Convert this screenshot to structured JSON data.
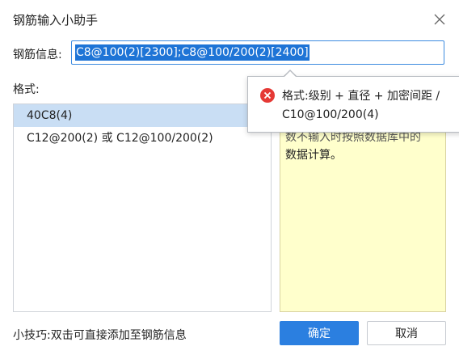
{
  "dialog": {
    "title": "钢筋输入小助手",
    "close_icon": "close-icon"
  },
  "info": {
    "label": "钢筋信息:",
    "value": "C8@100(2)[2300];C8@100/200(2)[2400]"
  },
  "format": {
    "label": "格式:",
    "items": [
      "40C8(4)",
      "C12@200(2) 或 C12@100/200(2)"
    ],
    "selected_index": 0
  },
  "description": {
    "line1": "数不输入时按照数据库中的",
    "line2": "数据计算。"
  },
  "tooltip": {
    "icon": "error-icon",
    "line1": "格式:级别 + 直径 + 加密间距 /",
    "line2": "C10@100/200(4)"
  },
  "footer": {
    "tip": "小技巧:双击可直接添加至钢筋信息",
    "ok_label": "确定",
    "cancel_label": "取消"
  },
  "colors": {
    "primary": "#2b7fe0",
    "selection": "#1e74d6",
    "list_selected": "#c9def4",
    "desc_bg": "#ffffcc",
    "error": "#e53935"
  }
}
